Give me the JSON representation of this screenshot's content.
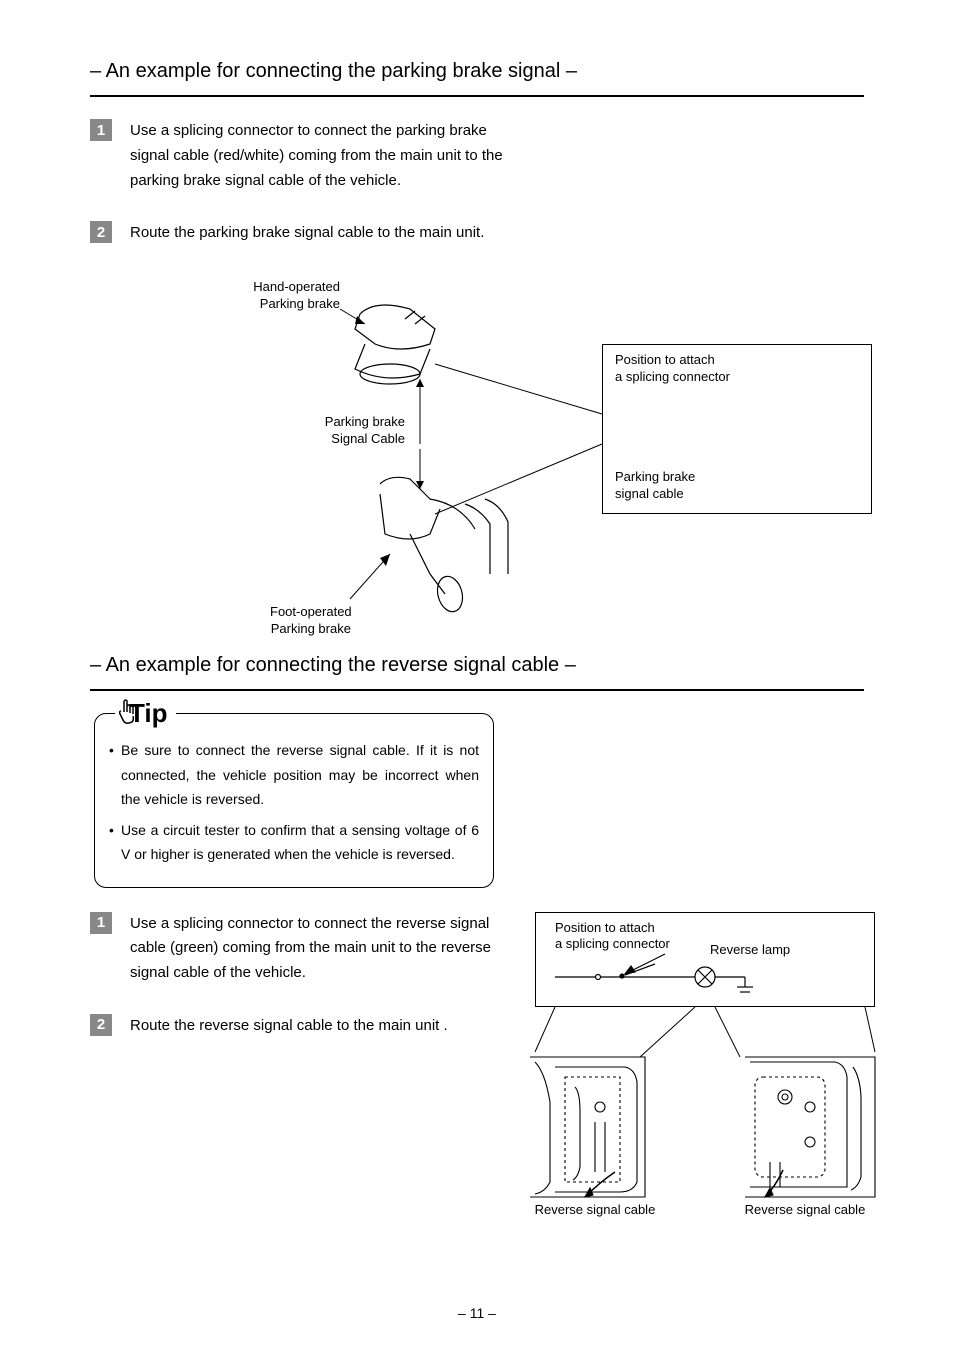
{
  "section1": {
    "title": "– An example for connecting the parking brake signal –",
    "step1_num": "1",
    "step1_text": "Use a splicing connector to connect the parking brake signal cable (red/white) coming from the main unit to the parking brake signal cable of the vehicle.",
    "step2_num": "2",
    "step2_text": "Route the parking brake signal cable to the main unit.",
    "diagram": {
      "hand_brake": "Hand-operated\nParking brake",
      "signal_cable": "Parking brake\nSignal Cable",
      "foot_brake": "Foot-operated\nParking brake",
      "attach_pos": "Position to attach\na splicing connector",
      "schematic_cable": "Parking brake\nsignal cable"
    }
  },
  "section2": {
    "title": "– An example for connecting the reverse signal cable –",
    "tip_label": "Tip",
    "tip1": "Be sure to connect the reverse signal cable. If it is not connected, the vehicle position may be incorrect when the vehicle is reversed.",
    "tip2": "Use a circuit tester to confirm that a sensing voltage of 6 V or higher is generated when the vehicle is reversed.",
    "step1_num": "1",
    "step1_text": "Use a splicing connector to connect the reverse signal cable (green) coming from the main unit to the reverse signal cable of the vehicle.",
    "step2_num": "2",
    "step2_text": "Route the reverse signal cable to the main unit .",
    "diagram": {
      "attach_pos": "Position to attach\na splicing connector",
      "reverse_lamp": "Reverse lamp",
      "reverse_cable_left": "Reverse signal cable",
      "reverse_cable_right": "Reverse signal cable"
    }
  },
  "page_number": "– 11 –"
}
